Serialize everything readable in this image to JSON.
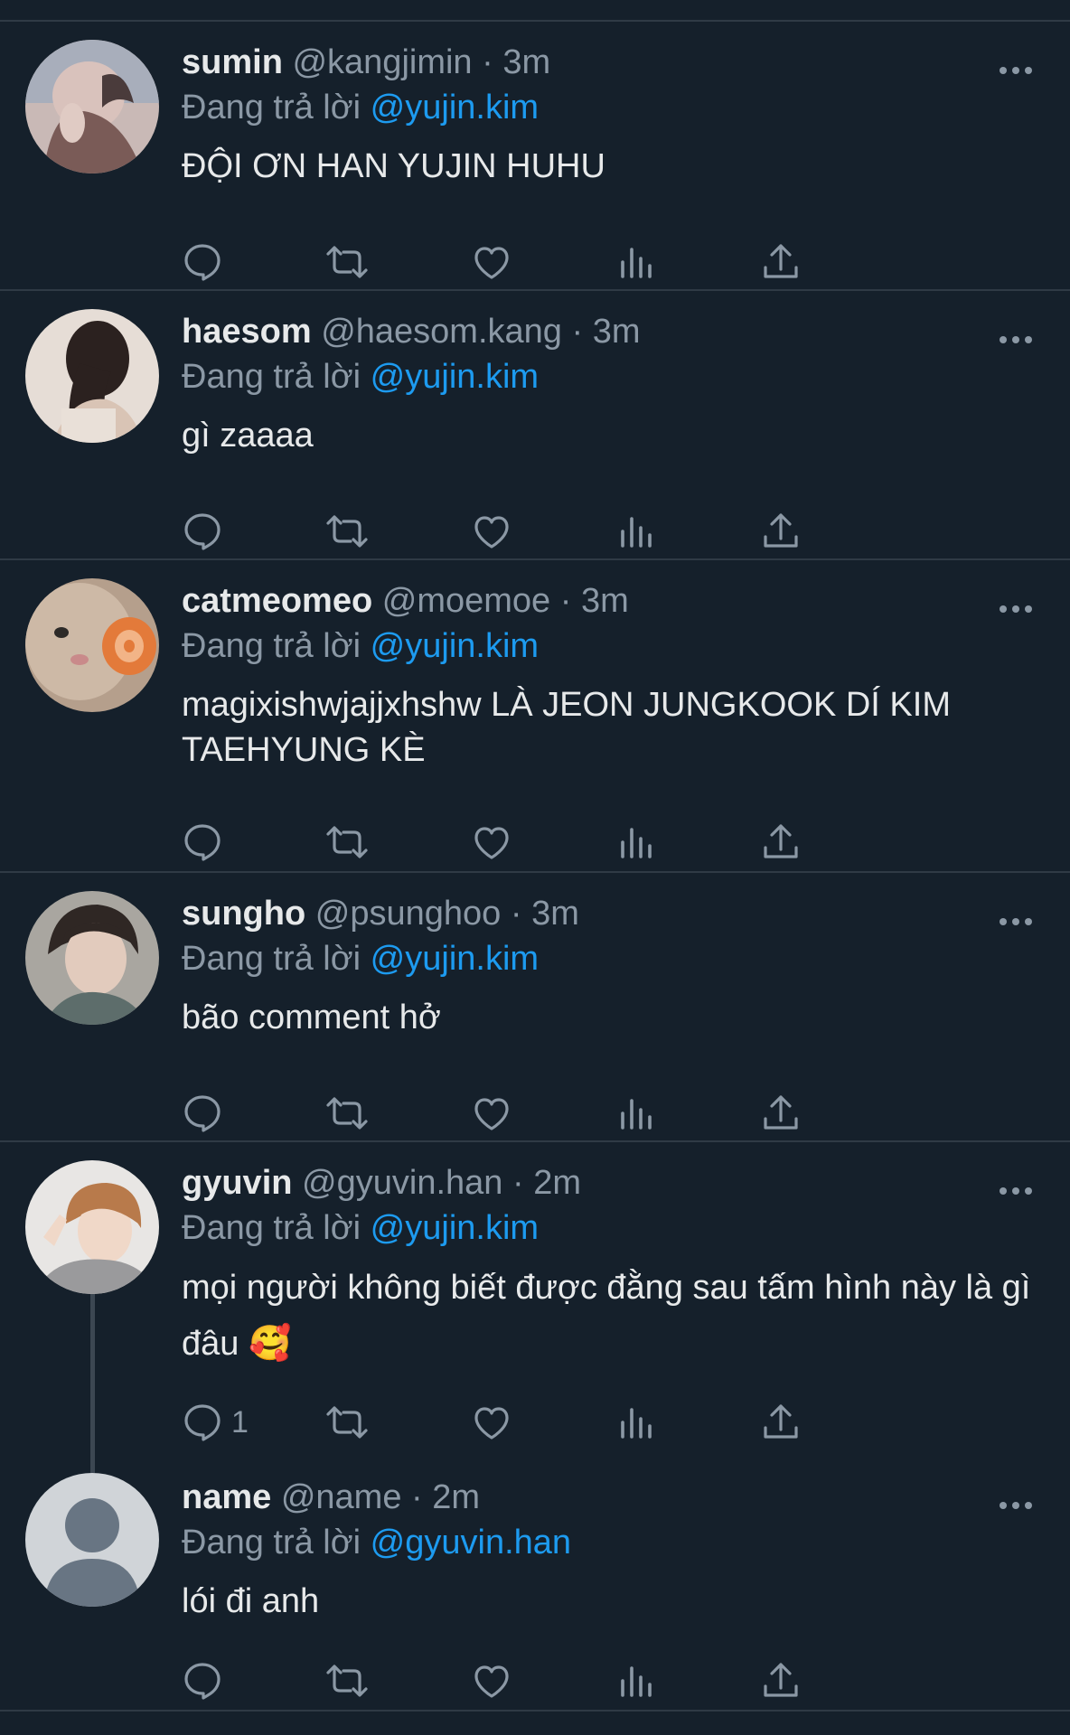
{
  "colors": {
    "background": "#15202b",
    "divider": "#2f3a45",
    "primary_text": "#e7e9ea",
    "secondary_text": "#8b98a5",
    "accent": "#1d9bf0"
  },
  "reply_prefix": "Đang trả lời",
  "icons": {
    "more": "more-dots-icon",
    "reply": "comment-bubble-icon",
    "retweet": "retweet-icon",
    "like": "heart-icon",
    "views": "bar-chart-icon",
    "share": "share-upload-icon"
  },
  "tweets": [
    {
      "name": "sumin",
      "handle": "@kangjimin",
      "time": "3m",
      "replying_to": "@yujin.kim",
      "text": "ĐỘI ƠN HAN YUJIN HUHU",
      "reply_count": ""
    },
    {
      "name": "haesom",
      "handle": "@haesom.kang",
      "time": "3m",
      "replying_to": "@yujin.kim",
      "text": "gì zaaaa",
      "reply_count": ""
    },
    {
      "name": "catmeomeo",
      "handle": "@moemoe",
      "time": "3m",
      "replying_to": "@yujin.kim",
      "text": "magixishwjajjxhshw LÀ JEON JUNGKOOK DÍ KIM TAEHYUNG KÈ",
      "reply_count": ""
    },
    {
      "name": "sungho",
      "handle": "@psunghoo",
      "time": "3m",
      "replying_to": "@yujin.kim",
      "text": "bão comment hở",
      "reply_count": ""
    },
    {
      "name": "gyuvin",
      "handle": "@gyuvin.han",
      "time": "2m",
      "replying_to": "@yujin.kim",
      "text": "mọi người không biết được đằng sau tấm hình này là gì đâu 🥰",
      "reply_count": "1"
    },
    {
      "name": "name",
      "handle": "@name",
      "time": "2m",
      "replying_to": "@gyuvin.han",
      "text": "lói đi anh",
      "reply_count": ""
    }
  ]
}
